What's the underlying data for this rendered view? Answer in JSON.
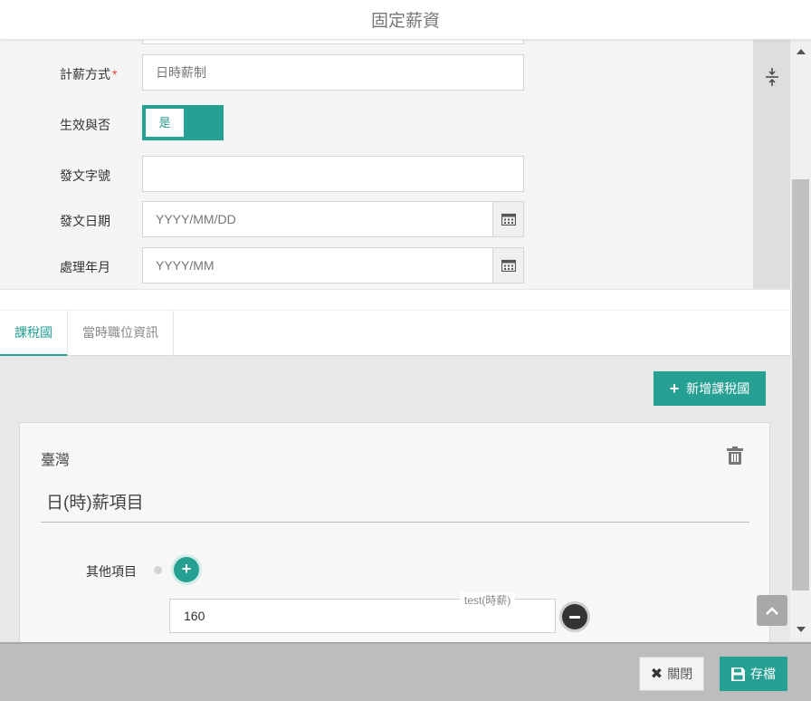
{
  "dialog": {
    "title": "固定薪資"
  },
  "form": {
    "pay_method": {
      "label": "計薪方式",
      "required_mark": "*",
      "placeholder": "日時薪制"
    },
    "effective": {
      "label": "生效與否",
      "value": "是"
    },
    "doc_number": {
      "label": "發文字號",
      "value": ""
    },
    "doc_date": {
      "label": "發文日期",
      "placeholder": "YYYY/MM/DD"
    },
    "process_month": {
      "label": "處理年月",
      "placeholder": "YYYY/MM"
    }
  },
  "tabs": [
    {
      "label": "課稅國",
      "active": true
    },
    {
      "label": "當時職位資訊",
      "active": false
    }
  ],
  "content": {
    "add_country_label": "新增課稅國",
    "country": {
      "name": "臺灣",
      "section_title": "日(時)薪項目",
      "other_items_label": "其他項目",
      "item": {
        "label": "test(時薪)",
        "value": "160"
      }
    }
  },
  "footer": {
    "close_label": "關閉",
    "save_label": "存檔"
  },
  "icons": {
    "calendar": "calendar-icon",
    "collapse": "collapse-vertical-icon",
    "trash": "trash-icon",
    "plus": "plus-icon",
    "minus": "minus-icon",
    "close": "close-icon",
    "save": "floppy-disk-icon",
    "scroll_top": "chevron-up-icon"
  },
  "colors": {
    "accent": "#26a093",
    "required": "#e53935",
    "footer": "#bdbdbd"
  }
}
